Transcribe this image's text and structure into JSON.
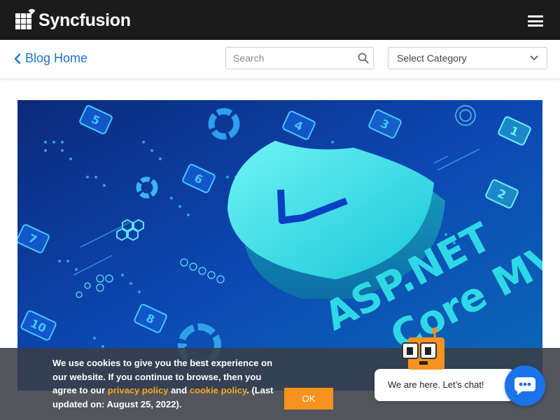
{
  "header": {
    "logo_text": "Syncfusion",
    "menu_icon": "hamburger-menu-icon"
  },
  "nav": {
    "blog_home": "Blog Home",
    "search": {
      "placeholder": "Search",
      "value": ""
    },
    "category_select": {
      "selected": "Select Category"
    }
  },
  "hero": {
    "title_line1": "ASP.NET",
    "title_line2": "Core MVC",
    "tiles": [
      "1",
      "2",
      "3",
      "4",
      "5",
      "6",
      "7",
      "8",
      "10"
    ]
  },
  "cookie_banner": {
    "text_1": "We use cookies to give you the best experience on our website. If you continue to browse, then you agree to our ",
    "privacy_link": "privacy policy",
    "text_2": " and ",
    "cookie_link": "cookie policy",
    "text_3": ". (Last updated on: August 25, 2022).",
    "ok_label": "OK"
  },
  "chat": {
    "greeting": "We are here. Let’s chat!"
  },
  "colors": {
    "topbar": "#1b1b1b",
    "link": "#1a73d6",
    "accent_orange": "#f7921e",
    "chat_blue": "#1a73e8"
  }
}
